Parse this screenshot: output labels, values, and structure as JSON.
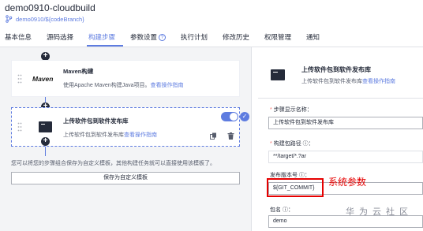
{
  "header": {
    "title": "demo0910-cloudbuild",
    "branch": "demo0910/${codeBranch}"
  },
  "tabs": [
    {
      "label": "基本信息"
    },
    {
      "label": "源码选择"
    },
    {
      "label": "构建步骤"
    },
    {
      "label": "参数设置"
    },
    {
      "label": "执行计划"
    },
    {
      "label": "修改历史"
    },
    {
      "label": "权限管理"
    },
    {
      "label": "通知"
    }
  ],
  "active_tab": "构建步骤",
  "steps": [
    {
      "logo": "Maven",
      "title": "Maven构建",
      "desc": "使用Apache Maven构建Java项目。",
      "link": "查看操作指南"
    },
    {
      "icon": "terminal-icon",
      "title": "上传软件包到软件发布库",
      "desc": "上传软件包到软件发布库",
      "link": "查看操作指南",
      "enabled": true
    }
  ],
  "hint": "您可以将您的步骤组合保存为自定义模板，其他构建任务就可以直接使用该模板了。",
  "save_template_label": "保存为自定义模板",
  "detail": {
    "title": "上传软件包到软件发布库",
    "desc": "上传软件包到软件发布库",
    "link": "查看操作指南",
    "fields": [
      {
        "label": "步骤显示名称：",
        "required": true,
        "value": "上传软件包到软件发布库"
      },
      {
        "label": "构建包路径 ⓘ：",
        "required": true,
        "value": "**/target/*.?ar"
      },
      {
        "label": "发布版本号 ⓘ：",
        "required": false,
        "value": "${GIT_COMMIT}"
      },
      {
        "label": "包名 ⓘ：",
        "required": false,
        "value": "demo"
      }
    ]
  },
  "annotation": "系统参数",
  "watermark": "华为云社区",
  "colors": {
    "accent": "#5e7ce0",
    "highlight": "#e60000",
    "left_bg": "#f3f4f6"
  }
}
